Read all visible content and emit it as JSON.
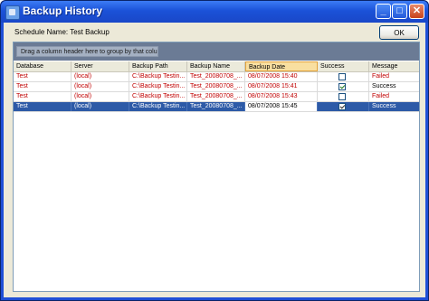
{
  "window": {
    "title": "Backup History",
    "minimize_glyph": "_",
    "maximize_glyph": "□",
    "close_glyph": "✕"
  },
  "schedule": {
    "label": "Schedule Name: Test Backup"
  },
  "ok_button": {
    "label": "OK"
  },
  "grid": {
    "group_hint": "Drag a column header here to group by that column.",
    "columns": [
      "Database",
      "Server",
      "Backup Path",
      "Backup Name",
      "Backup Date",
      "Success",
      "Message"
    ],
    "sorted_column": "Backup Date",
    "rows": [
      {
        "database": "Test",
        "server": "(local)",
        "path": "C:\\Backup Testin...",
        "name": "Test_20080708_...",
        "date": "08/07/2008 15:40",
        "success": false,
        "message": "Failed"
      },
      {
        "database": "Test",
        "server": "(local)",
        "path": "C:\\Backup Testin...",
        "name": "Test_20080708_...",
        "date": "08/07/2008 15:41",
        "success": true,
        "message": "Success"
      },
      {
        "database": "Test",
        "server": "(local)",
        "path": "C:\\Backup Testin...",
        "name": "Test_20080708_...",
        "date": "08/07/2008 15:43",
        "success": false,
        "message": "Failed"
      },
      {
        "database": "Test",
        "server": "(local)",
        "path": "C:\\Backup Testin...",
        "name": "Test_20080708_...",
        "date": "08/07/2008 15:45",
        "success": true,
        "message": "Success",
        "selected": true
      }
    ]
  },
  "colors": {
    "title_bar": "#1b52d8",
    "failed_text": "#c00000",
    "selected_row": "#2d5aa7",
    "sorted_header": "#f9dfa0"
  }
}
